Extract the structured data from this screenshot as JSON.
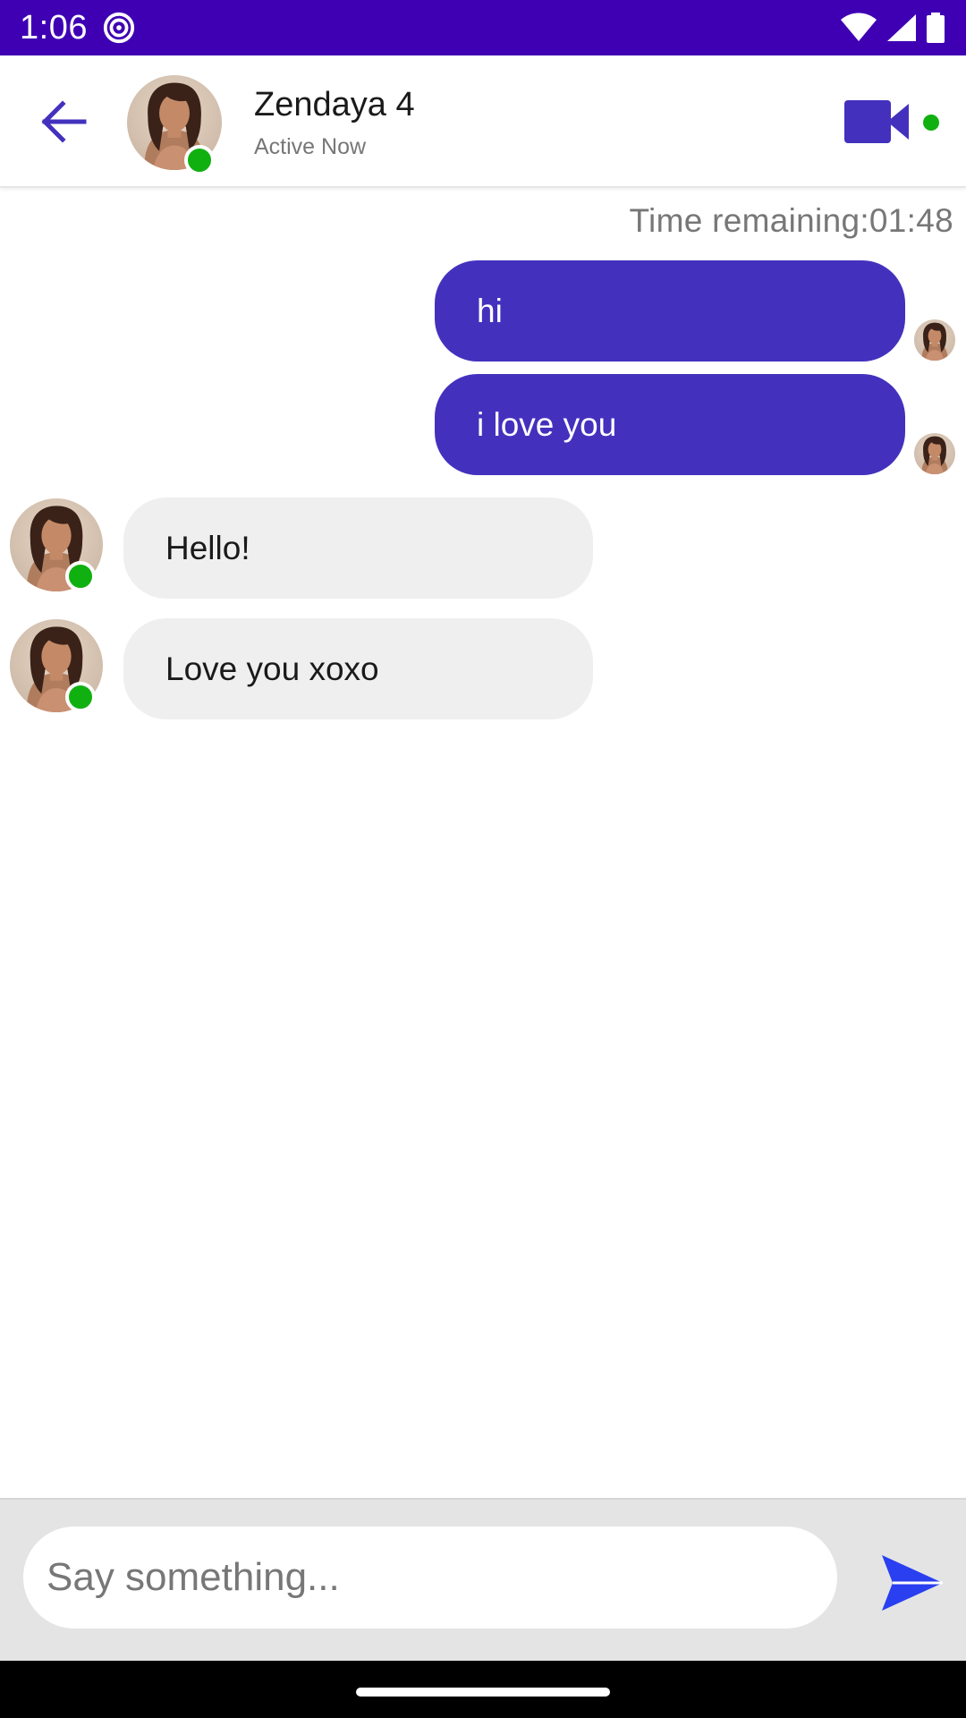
{
  "status_bar": {
    "time": "1:06",
    "background": "#3f00b4"
  },
  "header": {
    "contact_name": "Zendaya 4",
    "contact_status": "Active Now",
    "accent_color": "#4331be",
    "online_color": "#11b011"
  },
  "chat": {
    "time_remaining": "Time remaining:01:48",
    "messages": [
      {
        "direction": "outgoing",
        "text": "hi"
      },
      {
        "direction": "outgoing",
        "text": "i love you"
      },
      {
        "direction": "incoming",
        "text": "Hello!"
      },
      {
        "direction": "incoming",
        "text": "Love you xoxo"
      }
    ]
  },
  "composer": {
    "placeholder": "Say something...",
    "value": ""
  },
  "icons": {
    "back": "arrow-left-icon",
    "video": "video-camera-icon",
    "send": "send-icon"
  }
}
